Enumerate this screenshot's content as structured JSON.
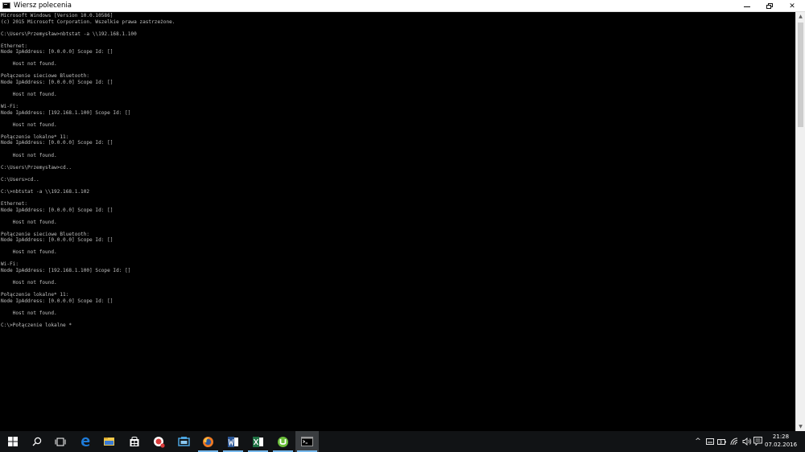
{
  "window": {
    "title": "Wiersz polecenia",
    "icon": "cmd-icon",
    "controls": {
      "minimize": "minimize-icon",
      "maximize": "restore-icon",
      "close": "close-icon",
      "close_glyph": "✕"
    }
  },
  "console": {
    "lines": [
      "Microsoft Windows [Version 10.0.10586]",
      "(c) 2015 Microsoft Corporation. Wszelkie prawa zastrzeżone.",
      "",
      "C:\\Users\\Przemysław>nbtstat -a \\\\192.168.1.100",
      "",
      "Ethernet:",
      "Node IpAddress: [0.0.0.0] Scope Id: []",
      "",
      "    Host not found.",
      "",
      "Połączenie sieciowe Bluetooth:",
      "Node IpAddress: [0.0.0.0] Scope Id: []",
      "",
      "    Host not found.",
      "",
      "Wi-Fi:",
      "Node IpAddress: [192.168.1.100] Scope Id: []",
      "",
      "    Host not found.",
      "",
      "Połączenie lokalne* 11:",
      "Node IpAddress: [0.0.0.0] Scope Id: []",
      "",
      "    Host not found.",
      "",
      "C:\\Users\\Przemysław>cd..",
      "",
      "C:\\Users>cd..",
      "",
      "C:\\>nbtstat -a \\\\192.168.1.102",
      "",
      "Ethernet:",
      "Node IpAddress: [0.0.0.0] Scope Id: []",
      "",
      "    Host not found.",
      "",
      "Połączenie sieciowe Bluetooth:",
      "Node IpAddress: [0.0.0.0] Scope Id: []",
      "",
      "    Host not found.",
      "",
      "Wi-Fi:",
      "Node IpAddress: [192.168.1.100] Scope Id: []",
      "",
      "    Host not found.",
      "",
      "Połączenie lokalne* 11:",
      "Node IpAddress: [0.0.0.0] Scope Id: []",
      "",
      "    Host not found.",
      "",
      "C:\\>Połączenie lokalne *"
    ]
  },
  "scrollbar": {
    "up": "▲",
    "down": "▼"
  },
  "taskbar": {
    "items": [
      {
        "name": "start-button",
        "icon": "windows-logo-icon"
      },
      {
        "name": "search-button",
        "icon": "search-icon"
      },
      {
        "name": "task-view-button",
        "icon": "task-view-icon"
      },
      {
        "name": "edge-button",
        "icon": "edge-icon"
      },
      {
        "name": "file-explorer-button",
        "icon": "folder-icon"
      },
      {
        "name": "store-button",
        "icon": "store-icon"
      },
      {
        "name": "app-button-1",
        "icon": "app-icon"
      },
      {
        "name": "app-button-2",
        "icon": "app-icon"
      },
      {
        "name": "firefox-button",
        "icon": "firefox-icon"
      },
      {
        "name": "word-button",
        "icon": "word-icon"
      },
      {
        "name": "excel-button",
        "icon": "excel-icon"
      },
      {
        "name": "utorrent-button",
        "icon": "utorrent-icon"
      },
      {
        "name": "cmd-taskbar-button",
        "icon": "cmd-icon"
      }
    ],
    "tray": {
      "chevron": "^",
      "clock_time": "21:28",
      "clock_date": "07.02.2016"
    },
    "colors": {
      "background": "#111315",
      "active_indicator": "#76b9ed",
      "edge": "#1e7ad6",
      "folder": "#f2c94c",
      "firefox": "#f07a22",
      "word": "#2b5797",
      "excel": "#1f7244",
      "utorrent": "#6bbf3a"
    }
  }
}
